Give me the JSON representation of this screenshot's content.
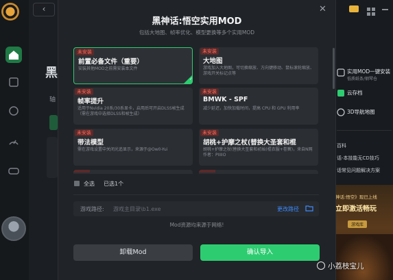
{
  "dialog": {
    "title": "黑神话:悟空实用MOD",
    "subtitle": "包括大地图、帧率优化、模型更换等多个实用MOD",
    "close_glyph": "✕",
    "cards": [
      {
        "tag": "未安装",
        "title": "前置必备文件（重要）",
        "desc": "安装其他MOD之前需安装本文件",
        "selected": true
      },
      {
        "tag": "未安装",
        "title": "大地图",
        "desc": "游戏加入大地图，可切换缩放、方向键移动、鼠标滚轮缩放、游戏开关标记点等"
      },
      {
        "tag": "未安装",
        "title": "帧率提升",
        "desc": "适用于Nvidia 20系/30系显卡，启用后可开启DLSS帧生成（需在游戏中选择DLSS和帧生成）"
      },
      {
        "tag": "未安装",
        "title": "BMWK - SPF",
        "desc": "减少延迟，加快加载时间，提高 CPU 和 GPU 利用率"
      },
      {
        "tag": "未安装",
        "title": "带法模型",
        "desc": "需在游戏设置中关闭光追显示，来源于@Ow0-Yui"
      },
      {
        "tag": "未安装",
        "title": "胡桃+护摩之杖(替换大圣套和棍",
        "desc": "胡桃+护摩之杖(替换大圣套和初始(棍衣服+卷簧)，来自N网作者：PIIIIO"
      }
    ],
    "select_all": "全选",
    "selected_count": "已选1个",
    "game_path_label": "游戏路径:",
    "game_path_placeholder": "游戏主目录\\b1.exe",
    "change_path": "更改路径",
    "source_note": "Mod资源均来源于网络!",
    "uninstall_button": "卸载Mod",
    "install_button": "确认导入"
  },
  "background": {
    "left_title_char": "黑",
    "left_small_char": "轴",
    "back_glyph": "‹"
  },
  "right_panel": {
    "items": [
      "实用MOD一键安装",
      "低质纸条/钢琴仓",
      "云存档",
      "3D导航地图",
      "百科",
      "话-本技能无CD技巧",
      "话常见问题解决方案"
    ],
    "banner_lines": [
      "神话:悟空》现已上线",
      "立即激活畅玩",
      "游戏库"
    ]
  },
  "watermark": "小荔枝宝儿",
  "colors": {
    "accent": "#2ecc71",
    "tag_red": "#ff6a5a",
    "link_blue": "#3d8bfd"
  }
}
